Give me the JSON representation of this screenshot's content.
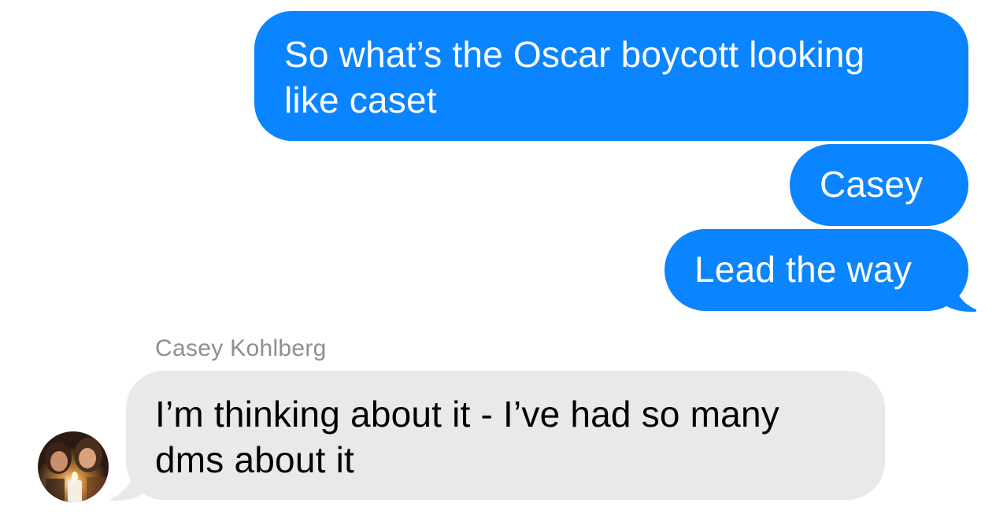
{
  "conversation": {
    "outgoing": [
      {
        "text": "So what’s the Oscar boycott looking\nlike caset"
      },
      {
        "text": "Casey"
      },
      {
        "text": "Lead the way"
      }
    ],
    "incoming": {
      "sender_name": "Casey Kohlberg",
      "text": "I’m thinking about it - I’ve had so many\ndms about it"
    }
  },
  "colors": {
    "sent_bubble": "#0a84ff",
    "received_bubble": "#e9e9eb",
    "sender_name": "#8e8e93"
  }
}
